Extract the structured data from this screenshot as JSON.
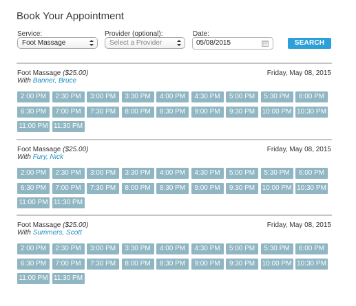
{
  "page": {
    "title": "Book Your Appointment"
  },
  "form": {
    "service_label": "Service:",
    "service_value": "Foot Massage",
    "provider_label": "Provider (optional):",
    "provider_placeholder": "Select a Provider",
    "date_label": "Date:",
    "date_value": "05/08/2015",
    "search_label": "SEARCH"
  },
  "sections": [
    {
      "service": "Foot Massage",
      "price": "($25.00)",
      "with_label": "With",
      "provider": "Banner, Bruce",
      "date": "Friday, May 08, 2015",
      "slots": [
        "2:00 PM",
        "2:30 PM",
        "3:00 PM",
        "3:30 PM",
        "4:00 PM",
        "4:30 PM",
        "5:00 PM",
        "5:30 PM",
        "6:00 PM",
        "6:30 PM",
        "7:00 PM",
        "7:30 PM",
        "8:00 PM",
        "8:30 PM",
        "9:00 PM",
        "9:30 PM",
        "10:00 PM",
        "10:30 PM",
        "11:00 PM",
        "11:30 PM"
      ]
    },
    {
      "service": "Foot Massage",
      "price": "($25.00)",
      "with_label": "With",
      "provider": "Fury, Nick",
      "date": "Friday, May 08, 2015",
      "slots": [
        "2:00 PM",
        "2:30 PM",
        "3:00 PM",
        "3:30 PM",
        "4:00 PM",
        "4:30 PM",
        "5:00 PM",
        "5:30 PM",
        "6:00 PM",
        "6:30 PM",
        "7:00 PM",
        "7:30 PM",
        "8:00 PM",
        "8:30 PM",
        "9:00 PM",
        "9:30 PM",
        "10:00 PM",
        "10:30 PM",
        "11:00 PM",
        "11:30 PM"
      ]
    },
    {
      "service": "Foot Massage",
      "price": "($25.00)",
      "with_label": "With",
      "provider": "Summers, Scott",
      "date": "Friday, May 08, 2015",
      "slots": [
        "2:00 PM",
        "2:30 PM",
        "3:00 PM",
        "3:30 PM",
        "4:00 PM",
        "4:30 PM",
        "5:00 PM",
        "5:30 PM",
        "6:00 PM",
        "6:30 PM",
        "7:00 PM",
        "7:30 PM",
        "8:00 PM",
        "8:30 PM",
        "9:00 PM",
        "9:30 PM",
        "10:00 PM",
        "10:30 PM",
        "11:00 PM",
        "11:30 PM"
      ]
    }
  ],
  "colors": {
    "accent": "#2d9fd9",
    "slot_bg": "#8fb6c2",
    "provider_link": "#1e8fc6",
    "divider": "#c4c4c4"
  },
  "icons": {
    "date_picker": "calendar-icon",
    "select_arrows": "select-arrows-icon"
  }
}
